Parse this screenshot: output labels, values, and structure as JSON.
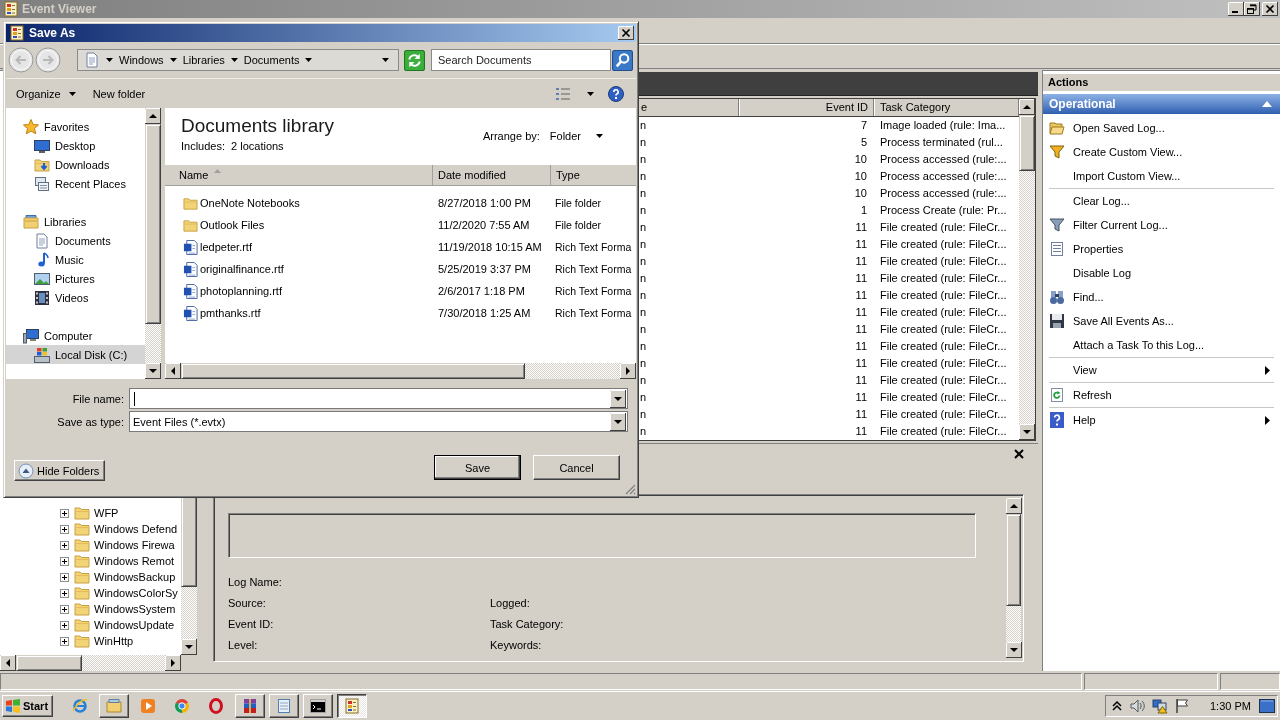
{
  "window": {
    "title": "Event Viewer"
  },
  "save_dialog": {
    "title": "Save As",
    "breadcrumb": [
      "Windows",
      "Libraries",
      "Documents"
    ],
    "search": {
      "placeholder": "Search Documents"
    },
    "toolbar": {
      "organize": "Organize",
      "new_folder": "New folder"
    },
    "nav": {
      "groups": [
        {
          "label": "Favorites",
          "selected": false,
          "children": [
            {
              "label": "Desktop",
              "selected": false
            },
            {
              "label": "Downloads",
              "selected": false
            },
            {
              "label": "Recent Places",
              "selected": false
            }
          ]
        },
        {
          "label": "Libraries",
          "selected": false,
          "children": [
            {
              "label": "Documents",
              "selected": false
            },
            {
              "label": "Music",
              "selected": false
            },
            {
              "label": "Pictures",
              "selected": false
            },
            {
              "label": "Videos",
              "selected": false
            }
          ]
        },
        {
          "label": "Computer",
          "selected": false,
          "children": [
            {
              "label": "Local Disk (C:)",
              "selected": true
            }
          ]
        }
      ]
    },
    "library": {
      "title": "Documents library",
      "includes_label": "Includes:",
      "locations_link": "2 locations",
      "arrange_label": "Arrange by:",
      "arrange_value": "Folder"
    },
    "file_list": {
      "columns": [
        {
          "label": "Name",
          "sorted": true
        },
        {
          "label": "Date modified",
          "sorted": false
        },
        {
          "label": "Type",
          "sorted": false
        }
      ],
      "rows": [
        {
          "kind": "folder",
          "cells": [
            "OneNote Notebooks",
            "8/27/2018 1:00 PM",
            "File folder"
          ]
        },
        {
          "kind": "folder",
          "cells": [
            "Outlook Files",
            "11/2/2020 7:55 AM",
            "File folder"
          ]
        },
        {
          "kind": "document",
          "cells": [
            "ledpeter.rtf",
            "11/19/2018 10:15 AM",
            "Rich Text Forma"
          ]
        },
        {
          "kind": "document",
          "cells": [
            "originalfinance.rtf",
            "5/25/2019 3:37 PM",
            "Rich Text Forma"
          ]
        },
        {
          "kind": "document",
          "cells": [
            "photoplanning.rtf",
            "2/6/2017 1:18 PM",
            "Rich Text Forma"
          ]
        },
        {
          "kind": "document",
          "cells": [
            "pmthanks.rtf",
            "7/30/2018 1:25 AM",
            "Rich Text Forma"
          ]
        }
      ]
    },
    "file_name": {
      "label": "File name:",
      "focused": true
    },
    "save_type": {
      "label": "Save as type:",
      "value": "Event Files (*.evtx)"
    },
    "buttons": {
      "hide_folders": "Hide Folders",
      "save": "Save",
      "cancel": "Cancel"
    }
  },
  "event_list": {
    "columns": [
      "e",
      "Event ID",
      "Task Category"
    ],
    "rows": [
      [
        "n",
        "7",
        "Image loaded (rule: Ima..."
      ],
      [
        "n",
        "5",
        "Process terminated (rul..."
      ],
      [
        "n",
        "10",
        "Process accessed (rule:..."
      ],
      [
        "n",
        "10",
        "Process accessed (rule:..."
      ],
      [
        "n",
        "10",
        "Process accessed (rule:..."
      ],
      [
        "n",
        "1",
        "Process Create (rule: Pr..."
      ],
      [
        "n",
        "11",
        "File created (rule: FileCr..."
      ],
      [
        "n",
        "11",
        "File created (rule: FileCr..."
      ],
      [
        "n",
        "11",
        "File created (rule: FileCr..."
      ],
      [
        "n",
        "11",
        "File created (rule: FileCr..."
      ],
      [
        "n",
        "11",
        "File created (rule: FileCr..."
      ],
      [
        "n",
        "11",
        "File created (rule: FileCr..."
      ],
      [
        "n",
        "11",
        "File created (rule: FileCr..."
      ],
      [
        "n",
        "11",
        "File created (rule: FileCr..."
      ],
      [
        "n",
        "11",
        "File created (rule: FileCr..."
      ],
      [
        "n",
        "11",
        "File created (rule: FileCr..."
      ],
      [
        "n",
        "11",
        "File created (rule: FileCr..."
      ],
      [
        "n",
        "11",
        "File created (rule: FileCr..."
      ],
      [
        "n",
        "11",
        "File created (rule: FileCr..."
      ]
    ]
  },
  "actions": {
    "title": "Actions",
    "section": {
      "title": "Operational",
      "expanded": true
    },
    "groups": [
      {
        "items": [
          {
            "label": "Open Saved Log...",
            "submenu": false
          },
          {
            "label": "Create Custom View...",
            "submenu": false
          },
          {
            "label": "Import Custom View...",
            "submenu": false
          }
        ]
      },
      {
        "items": [
          {
            "label": "Clear Log...",
            "submenu": false
          },
          {
            "label": "Filter Current Log...",
            "submenu": false
          },
          {
            "label": "Properties",
            "submenu": false
          },
          {
            "label": "Disable Log",
            "submenu": false
          },
          {
            "label": "Find...",
            "submenu": false
          },
          {
            "label": "Save All Events As...",
            "submenu": false
          },
          {
            "label": "Attach a Task To this Log...",
            "submenu": false
          }
        ]
      },
      {
        "items": [
          {
            "label": "View",
            "submenu": true
          }
        ]
      },
      {
        "items": [
          {
            "label": "Refresh",
            "submenu": false
          }
        ]
      },
      {
        "items": [
          {
            "label": "Help",
            "submenu": true
          }
        ]
      }
    ]
  },
  "tree": {
    "items": [
      {
        "label": "WFP",
        "expanded": false
      },
      {
        "label": "Windows Defend",
        "expanded": false
      },
      {
        "label": "Windows Firewa",
        "expanded": false
      },
      {
        "label": "Windows Remot",
        "expanded": false
      },
      {
        "label": "WindowsBackup",
        "expanded": false
      },
      {
        "label": "WindowsColorSy",
        "expanded": false
      },
      {
        "label": "WindowsSystem",
        "expanded": false
      },
      {
        "label": "WindowsUpdate",
        "expanded": false
      },
      {
        "label": "WinHttp",
        "expanded": false
      }
    ]
  },
  "details_pane": {
    "rows": [
      {
        "cells": [
          "Log Name:"
        ]
      },
      {
        "cells": [
          "Source:",
          "Logged:"
        ]
      },
      {
        "cells": [
          "Event ID:",
          "Task Category:"
        ]
      },
      {
        "cells": [
          "Level:",
          "Keywords:"
        ]
      }
    ]
  },
  "taskbar": {
    "start": "Start",
    "items": [
      {
        "kind": "launcher",
        "selected": false
      },
      {
        "kind": "window",
        "selected": false
      },
      {
        "kind": "launcher",
        "selected": false
      },
      {
        "kind": "launcher",
        "selected": false
      },
      {
        "kind": "launcher",
        "selected": false
      },
      {
        "kind": "window",
        "selected": false
      },
      {
        "kind": "window",
        "selected": false
      },
      {
        "kind": "window",
        "selected": false
      },
      {
        "kind": "window",
        "selected": true
      }
    ],
    "clock": "1:30 PM"
  }
}
